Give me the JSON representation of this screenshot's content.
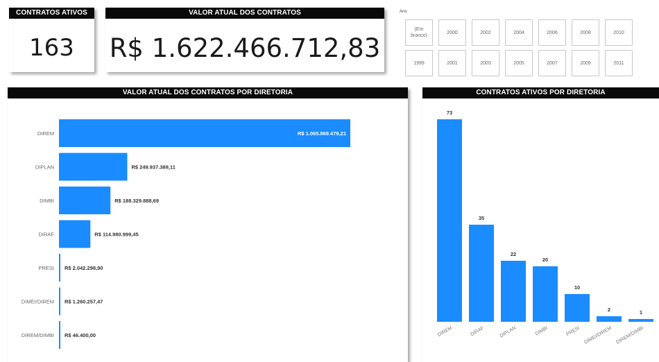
{
  "kpis": {
    "contratos_ativos": {
      "title": "CONTRATOS ATIVOS",
      "value": "163"
    },
    "valor_atual": {
      "title": "VALOR ATUAL DOS CONTRATOS",
      "value": "R$ 1.622.466.712,83"
    }
  },
  "slicer": {
    "label": "Ano",
    "row1": [
      "(Em branco)",
      "2000",
      "2002",
      "2004",
      "2006",
      "2008",
      "2010"
    ],
    "row2": [
      "1999",
      "2001",
      "2003",
      "2005",
      "2007",
      "2009",
      "2011"
    ]
  },
  "colors": {
    "bar": "#1a8cff",
    "header_bg": "#0a0a0a",
    "header_text": "#ffffff"
  },
  "chart_data": [
    {
      "type": "bar",
      "orientation": "horizontal",
      "title": "VALOR ATUAL DOS CONTRATOS POR DIRETORIA",
      "categories": [
        "DIREM",
        "DIPLAN",
        "DIMBI",
        "DIRAF",
        "PRESI",
        "DIMEI/DIREM",
        "DIREM/DIMBI"
      ],
      "values": [
        1065869479.21,
        249937389.11,
        188329888.69,
        114980999.45,
        2042298.9,
        1260257.47,
        46400.0
      ],
      "labels": [
        "R$ 1.065.869.479,21",
        "R$ 249.937.389,11",
        "R$ 188.329.888,69",
        "R$ 114.980.999,45",
        "R$ 2.042.298,90",
        "R$ 1.260.257,47",
        "R$ 46.400,00"
      ]
    },
    {
      "type": "bar",
      "orientation": "vertical",
      "title": "CONTRATOS ATIVOS POR DIRETORIA",
      "categories": [
        "DIREM",
        "DIRAF",
        "DIPLAN",
        "DIMBI",
        "PRESI",
        "DIMEI/DIREM",
        "DIREM/DIMBI"
      ],
      "values": [
        73,
        35,
        22,
        20,
        10,
        2,
        1
      ]
    }
  ]
}
